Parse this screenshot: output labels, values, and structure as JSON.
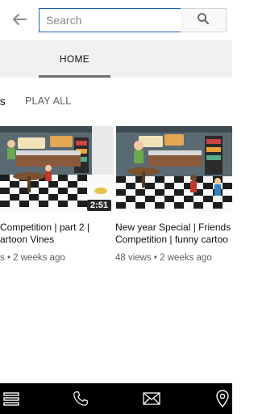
{
  "header": {
    "back_icon": "arrow-left-icon",
    "search_placeholder": "Search",
    "search_icon": "search-icon"
  },
  "tabs": [
    {
      "label": "HOME",
      "selected": true
    }
  ],
  "section": {
    "title": "ds",
    "play_all_label": "PLAY ALL"
  },
  "videos": [
    {
      "title_line1": "Competition | part 2 |",
      "title_line2": "artoon Vines",
      "meta": "s • 2 weeks ago",
      "duration": "2:51"
    },
    {
      "title_line1": "New year Special | Friends",
      "title_line2": "Competition | funny cartoo",
      "meta": "48 views • 2 weeks ago"
    }
  ],
  "bottom_bar": {
    "items": [
      "menu-icon",
      "phone-icon",
      "mail-icon",
      "location-pin-icon"
    ]
  },
  "colors": {
    "search_border": "#1c62b9",
    "tabbar_bg": "#f1f1f1",
    "bottom_bar_bg": "#000000"
  }
}
